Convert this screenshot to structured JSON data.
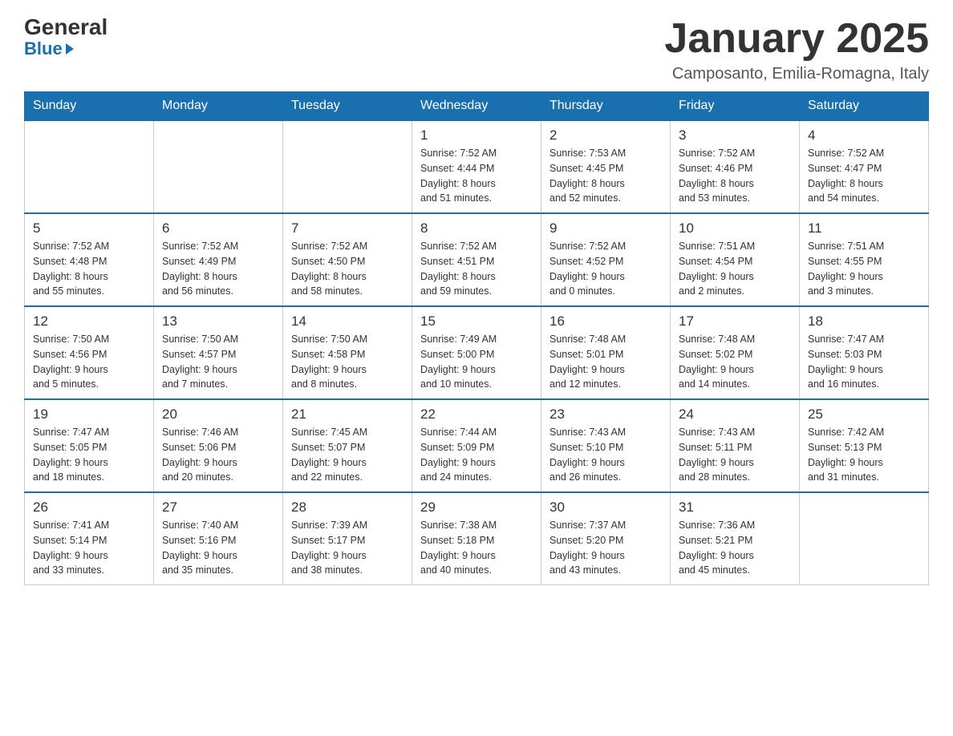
{
  "logo": {
    "general": "General",
    "blue": "Blue"
  },
  "title": "January 2025",
  "location": "Camposanto, Emilia-Romagna, Italy",
  "days_of_week": [
    "Sunday",
    "Monday",
    "Tuesday",
    "Wednesday",
    "Thursday",
    "Friday",
    "Saturday"
  ],
  "weeks": [
    [
      {
        "day": "",
        "info": ""
      },
      {
        "day": "",
        "info": ""
      },
      {
        "day": "",
        "info": ""
      },
      {
        "day": "1",
        "info": "Sunrise: 7:52 AM\nSunset: 4:44 PM\nDaylight: 8 hours\nand 51 minutes."
      },
      {
        "day": "2",
        "info": "Sunrise: 7:53 AM\nSunset: 4:45 PM\nDaylight: 8 hours\nand 52 minutes."
      },
      {
        "day": "3",
        "info": "Sunrise: 7:52 AM\nSunset: 4:46 PM\nDaylight: 8 hours\nand 53 minutes."
      },
      {
        "day": "4",
        "info": "Sunrise: 7:52 AM\nSunset: 4:47 PM\nDaylight: 8 hours\nand 54 minutes."
      }
    ],
    [
      {
        "day": "5",
        "info": "Sunrise: 7:52 AM\nSunset: 4:48 PM\nDaylight: 8 hours\nand 55 minutes."
      },
      {
        "day": "6",
        "info": "Sunrise: 7:52 AM\nSunset: 4:49 PM\nDaylight: 8 hours\nand 56 minutes."
      },
      {
        "day": "7",
        "info": "Sunrise: 7:52 AM\nSunset: 4:50 PM\nDaylight: 8 hours\nand 58 minutes."
      },
      {
        "day": "8",
        "info": "Sunrise: 7:52 AM\nSunset: 4:51 PM\nDaylight: 8 hours\nand 59 minutes."
      },
      {
        "day": "9",
        "info": "Sunrise: 7:52 AM\nSunset: 4:52 PM\nDaylight: 9 hours\nand 0 minutes."
      },
      {
        "day": "10",
        "info": "Sunrise: 7:51 AM\nSunset: 4:54 PM\nDaylight: 9 hours\nand 2 minutes."
      },
      {
        "day": "11",
        "info": "Sunrise: 7:51 AM\nSunset: 4:55 PM\nDaylight: 9 hours\nand 3 minutes."
      }
    ],
    [
      {
        "day": "12",
        "info": "Sunrise: 7:50 AM\nSunset: 4:56 PM\nDaylight: 9 hours\nand 5 minutes."
      },
      {
        "day": "13",
        "info": "Sunrise: 7:50 AM\nSunset: 4:57 PM\nDaylight: 9 hours\nand 7 minutes."
      },
      {
        "day": "14",
        "info": "Sunrise: 7:50 AM\nSunset: 4:58 PM\nDaylight: 9 hours\nand 8 minutes."
      },
      {
        "day": "15",
        "info": "Sunrise: 7:49 AM\nSunset: 5:00 PM\nDaylight: 9 hours\nand 10 minutes."
      },
      {
        "day": "16",
        "info": "Sunrise: 7:48 AM\nSunset: 5:01 PM\nDaylight: 9 hours\nand 12 minutes."
      },
      {
        "day": "17",
        "info": "Sunrise: 7:48 AM\nSunset: 5:02 PM\nDaylight: 9 hours\nand 14 minutes."
      },
      {
        "day": "18",
        "info": "Sunrise: 7:47 AM\nSunset: 5:03 PM\nDaylight: 9 hours\nand 16 minutes."
      }
    ],
    [
      {
        "day": "19",
        "info": "Sunrise: 7:47 AM\nSunset: 5:05 PM\nDaylight: 9 hours\nand 18 minutes."
      },
      {
        "day": "20",
        "info": "Sunrise: 7:46 AM\nSunset: 5:06 PM\nDaylight: 9 hours\nand 20 minutes."
      },
      {
        "day": "21",
        "info": "Sunrise: 7:45 AM\nSunset: 5:07 PM\nDaylight: 9 hours\nand 22 minutes."
      },
      {
        "day": "22",
        "info": "Sunrise: 7:44 AM\nSunset: 5:09 PM\nDaylight: 9 hours\nand 24 minutes."
      },
      {
        "day": "23",
        "info": "Sunrise: 7:43 AM\nSunset: 5:10 PM\nDaylight: 9 hours\nand 26 minutes."
      },
      {
        "day": "24",
        "info": "Sunrise: 7:43 AM\nSunset: 5:11 PM\nDaylight: 9 hours\nand 28 minutes."
      },
      {
        "day": "25",
        "info": "Sunrise: 7:42 AM\nSunset: 5:13 PM\nDaylight: 9 hours\nand 31 minutes."
      }
    ],
    [
      {
        "day": "26",
        "info": "Sunrise: 7:41 AM\nSunset: 5:14 PM\nDaylight: 9 hours\nand 33 minutes."
      },
      {
        "day": "27",
        "info": "Sunrise: 7:40 AM\nSunset: 5:16 PM\nDaylight: 9 hours\nand 35 minutes."
      },
      {
        "day": "28",
        "info": "Sunrise: 7:39 AM\nSunset: 5:17 PM\nDaylight: 9 hours\nand 38 minutes."
      },
      {
        "day": "29",
        "info": "Sunrise: 7:38 AM\nSunset: 5:18 PM\nDaylight: 9 hours\nand 40 minutes."
      },
      {
        "day": "30",
        "info": "Sunrise: 7:37 AM\nSunset: 5:20 PM\nDaylight: 9 hours\nand 43 minutes."
      },
      {
        "day": "31",
        "info": "Sunrise: 7:36 AM\nSunset: 5:21 PM\nDaylight: 9 hours\nand 45 minutes."
      },
      {
        "day": "",
        "info": ""
      }
    ]
  ]
}
